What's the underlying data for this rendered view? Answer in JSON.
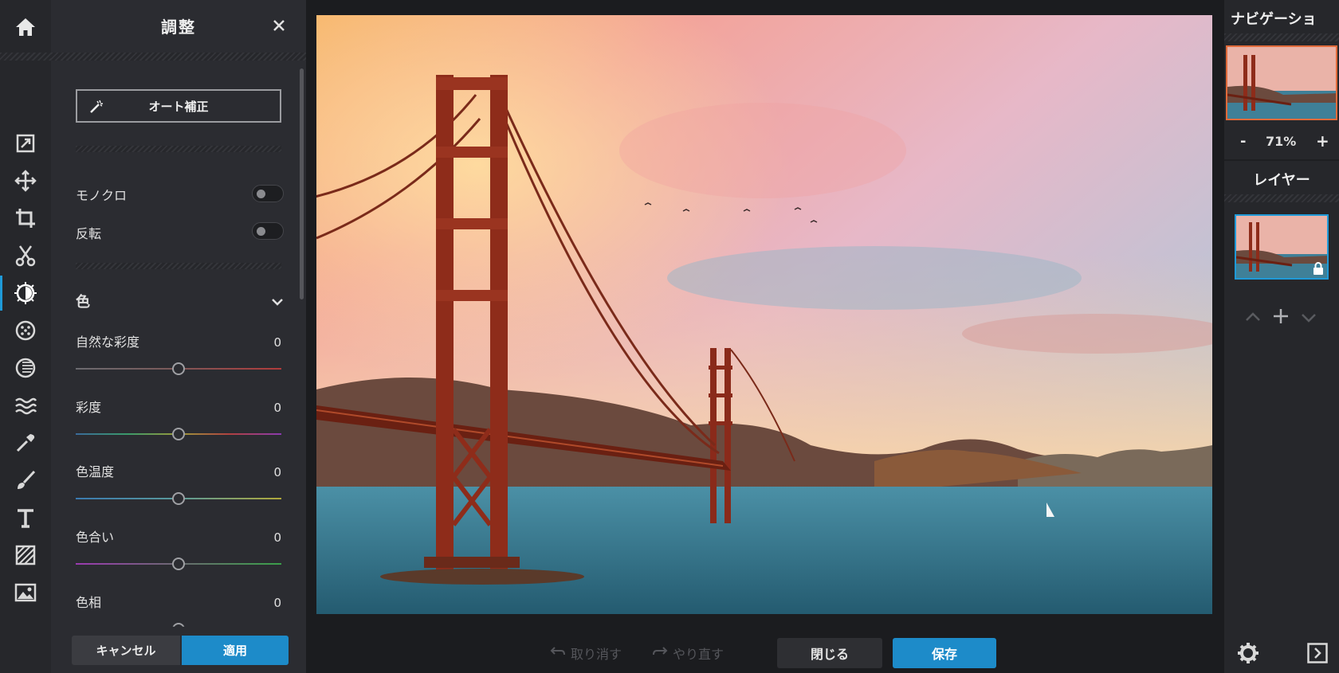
{
  "toolbar": {
    "tools": [
      "home-icon",
      "crop-resize-icon",
      "move-icon",
      "crop-icon",
      "cut-icon",
      "adjust-icon",
      "filter-icon",
      "vignette-icon",
      "wave-icon",
      "eyedropper-icon",
      "brush-icon",
      "text-icon",
      "pattern-icon",
      "image-icon"
    ],
    "active": "adjust-icon"
  },
  "panel": {
    "title": "調整",
    "auto_label": "オート補正",
    "mono_label": "モノクロ",
    "invert_label": "反転",
    "color_section": "色",
    "sliders": [
      {
        "label": "自然な彩度",
        "value": "0"
      },
      {
        "label": "彩度",
        "value": "0"
      },
      {
        "label": "色温度",
        "value": "0"
      },
      {
        "label": "色合い",
        "value": "0"
      },
      {
        "label": "色相",
        "value": "0"
      }
    ],
    "cancel_label": "キャンセル",
    "apply_label": "適用"
  },
  "canvas": {
    "undo_label": "取り消す",
    "redo_label": "やり直す",
    "close_label": "閉じる",
    "save_label": "保存"
  },
  "right": {
    "nav_title": "ナビゲーショ",
    "zoom_minus": "-",
    "zoom_value": "71%",
    "zoom_plus": "+",
    "layers_title": "レイヤー"
  },
  "colors": {
    "accent": "#1d8bc9",
    "panel_bg": "#2b2c31",
    "toolbar_bg": "#26272b",
    "canvas_bg": "#1b1c1f"
  }
}
